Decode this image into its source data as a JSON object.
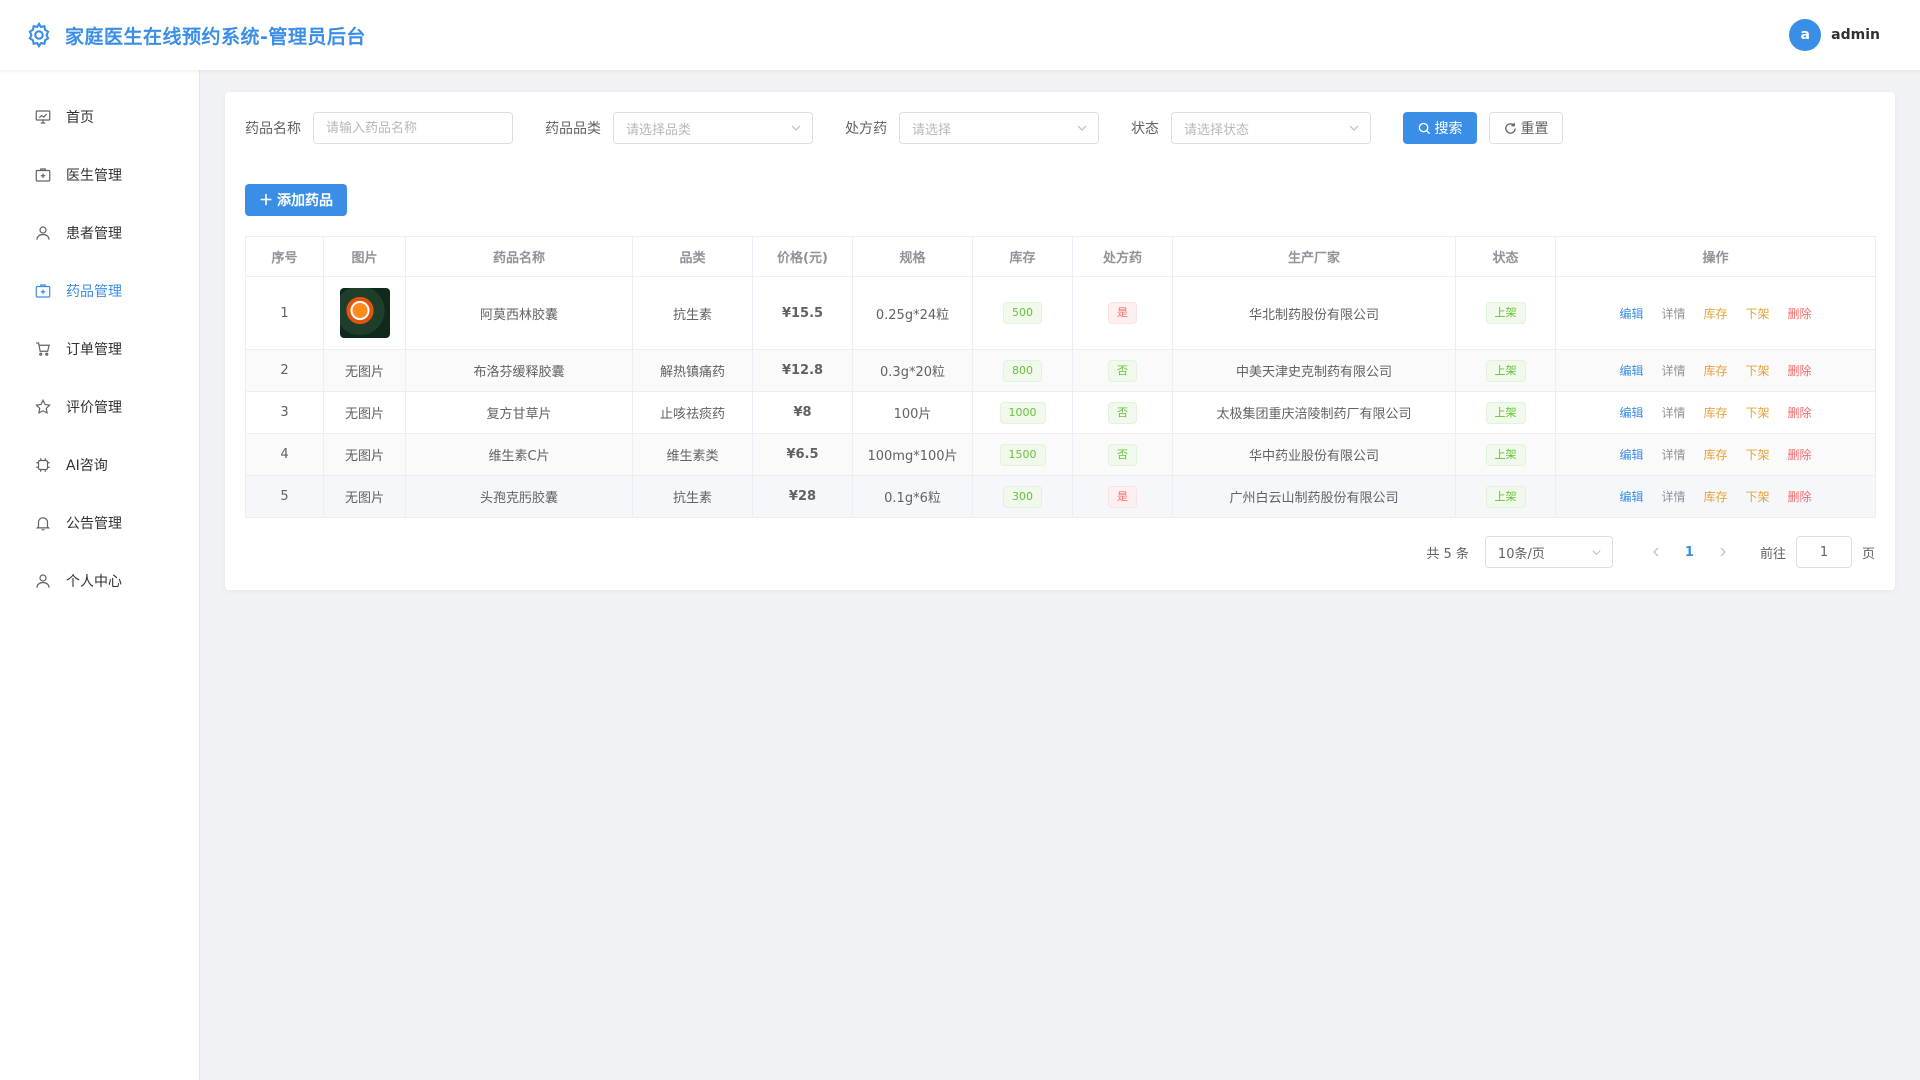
{
  "header": {
    "title": "家庭医生在线预约系统-管理员后台",
    "avatar_letter": "a",
    "username": "admin"
  },
  "sidebar": {
    "items": [
      {
        "label": "首页",
        "icon": "dashboard-icon"
      },
      {
        "label": "医生管理",
        "icon": "first-aid-icon"
      },
      {
        "label": "患者管理",
        "icon": "user-icon"
      },
      {
        "label": "药品管理",
        "icon": "first-aid-icon"
      },
      {
        "label": "订单管理",
        "icon": "cart-icon"
      },
      {
        "label": "评价管理",
        "icon": "star-icon"
      },
      {
        "label": "AI咨询",
        "icon": "cpu-icon"
      },
      {
        "label": "公告管理",
        "icon": "bell-icon"
      },
      {
        "label": "个人中心",
        "icon": "user-icon"
      }
    ],
    "active_index": 3
  },
  "search": {
    "name_label": "药品名称",
    "name_placeholder": "请输入药品名称",
    "category_label": "药品品类",
    "category_placeholder": "请选择品类",
    "rx_label": "处方药",
    "rx_placeholder": "请选择",
    "status_label": "状态",
    "status_placeholder": "请选择状态",
    "search_button": "搜索",
    "reset_button": "重置"
  },
  "add_button": "添加药品",
  "table": {
    "columns": [
      "序号",
      "图片",
      "药品名称",
      "品类",
      "价格(元)",
      "规格",
      "库存",
      "处方药",
      "生产厂家",
      "状态",
      "操作"
    ],
    "actions": {
      "edit": "编辑",
      "detail": "详情",
      "stock": "库存",
      "off_shelf": "下架",
      "delete": "删除"
    },
    "rows": [
      {
        "index": "1",
        "image": "",
        "name": "阿莫西林胶囊",
        "category": "抗生素",
        "price": "¥15.5",
        "spec": "0.25g*24粒",
        "stock": "500",
        "rx": "是",
        "manufacturer": "华北制药股份有限公司",
        "status": "上架"
      },
      {
        "index": "2",
        "image": "无图片",
        "name": "布洛芬缓释胶囊",
        "category": "解热镇痛药",
        "price": "¥12.8",
        "spec": "0.3g*20粒",
        "stock": "800",
        "rx": "否",
        "manufacturer": "中美天津史克制药有限公司",
        "status": "上架"
      },
      {
        "index": "3",
        "image": "无图片",
        "name": "复方甘草片",
        "category": "止咳祛痰药",
        "price": "¥8",
        "spec": "100片",
        "stock": "1000",
        "rx": "否",
        "manufacturer": "太极集团重庆涪陵制药厂有限公司",
        "status": "上架"
      },
      {
        "index": "4",
        "image": "无图片",
        "name": "维生素C片",
        "category": "维生素类",
        "price": "¥6.5",
        "spec": "100mg*100片",
        "stock": "1500",
        "rx": "否",
        "manufacturer": "华中药业股份有限公司",
        "status": "上架"
      },
      {
        "index": "5",
        "image": "无图片",
        "name": "头孢克肟胶囊",
        "category": "抗生素",
        "price": "¥28",
        "spec": "0.1g*6粒",
        "stock": "300",
        "rx": "是",
        "manufacturer": "广州白云山制药股份有限公司",
        "status": "上架"
      }
    ]
  },
  "pagination": {
    "total": "共 5 条",
    "page_size": "10条/页",
    "current_page": "1",
    "goto_label": "前往",
    "goto_value": "1",
    "suffix": "页"
  }
}
